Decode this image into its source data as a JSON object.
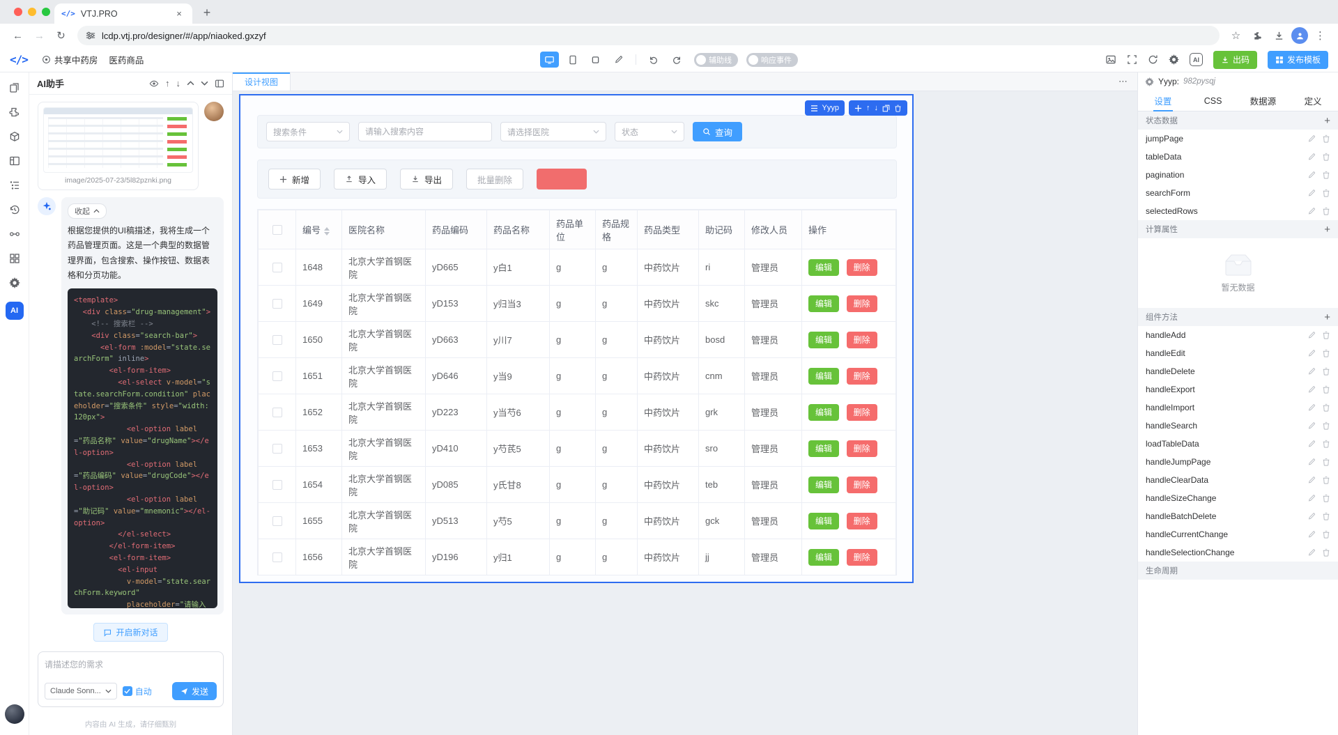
{
  "browser": {
    "tab_title": "VTJ.PRO",
    "url": "lcdp.vtj.pro/designer/#/app/niaoked.gxzyf"
  },
  "toolbar": {
    "breadcrumb1": "共享中药房",
    "breadcrumb2": "医药商品",
    "guide_toggle": "辅助线",
    "event_toggle": "响应事件",
    "export_code": "出码",
    "publish": "发布模板"
  },
  "ai_panel": {
    "title": "AI助手",
    "attachment_name": "image/2025-07-23/5l82pznki.png",
    "collapse": "收起",
    "message": "根据您提供的UI稿描述，我将生成一个药品管理页面。这是一个典型的数据管理界面，包含搜索、操作按钮、数据表格和分页功能。",
    "code": "<template>\n  <div class=\"drug-management\">\n    <!-- 搜索栏 -->\n    <div class=\"search-bar\">\n      <el-form :model=\"state.searchForm\" inline>\n        <el-form-item>\n          <el-select v-model=\"state.searchForm.condition\" placeholder=\"搜索条件\" style=\"width: 120px\">\n            <el-option label=\"药品名称\" value=\"drugName\"></el-option>\n            <el-option label=\"药品编码\" value=\"drugCode\"></el-option>\n            <el-option label=\"助记码\" value=\"mnemonic\"></el-option>\n          </el-select>\n        </el-form-item>\n        <el-form-item>\n          <el-input\n            v-model=\"state.searchForm.keyword\"\n            placeholder=\"请输入搜索内容\"",
    "new_chat": "开启新对话",
    "input_placeholder": "请描述您的需求",
    "model": "Claude Sonn...",
    "auto": "自动",
    "send": "发送",
    "disclaimer": "内容由 AI 生成，请仔细甄别"
  },
  "canvas": {
    "view_tab": "设计视图",
    "selection": {
      "name": "Yyyp"
    },
    "search": {
      "condition_placeholder": "搜索条件",
      "keyword_placeholder": "请输入搜索内容",
      "hospital_placeholder": "请选择医院",
      "status_placeholder": "状态",
      "submit": "查询"
    },
    "actions": {
      "add": "新增",
      "import": "导入",
      "export": "导出",
      "batch_delete": "批量删除"
    },
    "table": {
      "headers": [
        "编号",
        "医院名称",
        "药品编码",
        "药品名称",
        "药品单位",
        "药品规格",
        "药品类型",
        "助记码",
        "修改人员",
        "操作"
      ],
      "edit_label": "编辑",
      "delete_label": "删除",
      "rows": [
        {
          "id": "1648",
          "hospital": "北京大学首钢医院",
          "code": "yD665",
          "name": "y白1",
          "unit": "g",
          "spec": "g",
          "type": "中药饮片",
          "mnemonic": "ri",
          "editor": "管理员"
        },
        {
          "id": "1649",
          "hospital": "北京大学首钢医院",
          "code": "yD153",
          "name": "y归当3",
          "unit": "g",
          "spec": "g",
          "type": "中药饮片",
          "mnemonic": "skc",
          "editor": "管理员"
        },
        {
          "id": "1650",
          "hospital": "北京大学首钢医院",
          "code": "yD663",
          "name": "y川7",
          "unit": "g",
          "spec": "g",
          "type": "中药饮片",
          "mnemonic": "bosd",
          "editor": "管理员"
        },
        {
          "id": "1651",
          "hospital": "北京大学首钢医院",
          "code": "yD646",
          "name": "y当9",
          "unit": "g",
          "spec": "g",
          "type": "中药饮片",
          "mnemonic": "cnm",
          "editor": "管理员"
        },
        {
          "id": "1652",
          "hospital": "北京大学首钢医院",
          "code": "yD223",
          "name": "y当芍6",
          "unit": "g",
          "spec": "g",
          "type": "中药饮片",
          "mnemonic": "grk",
          "editor": "管理员"
        },
        {
          "id": "1653",
          "hospital": "北京大学首钢医院",
          "code": "yD410",
          "name": "y芍芪5",
          "unit": "g",
          "spec": "g",
          "type": "中药饮片",
          "mnemonic": "sro",
          "editor": "管理员"
        },
        {
          "id": "1654",
          "hospital": "北京大学首钢医院",
          "code": "yD085",
          "name": "y氏甘8",
          "unit": "g",
          "spec": "g",
          "type": "中药饮片",
          "mnemonic": "teb",
          "editor": "管理员"
        },
        {
          "id": "1655",
          "hospital": "北京大学首钢医院",
          "code": "yD513",
          "name": "y芍5",
          "unit": "g",
          "spec": "g",
          "type": "中药饮片",
          "mnemonic": "gck",
          "editor": "管理员"
        },
        {
          "id": "1656",
          "hospital": "北京大学首钢医院",
          "code": "yD196",
          "name": "y归1",
          "unit": "g",
          "spec": "g",
          "type": "中药饮片",
          "mnemonic": "jj",
          "editor": "管理员"
        }
      ]
    }
  },
  "inspector": {
    "component": "Yyyp:",
    "component_id": "982pysqj",
    "tabs": [
      "设置",
      "CSS",
      "数据源",
      "定义"
    ],
    "state": {
      "title": "状态数据",
      "items": [
        "jumpPage",
        "tableData",
        "pagination",
        "searchForm",
        "selectedRows"
      ]
    },
    "computed": {
      "title": "计算属性",
      "empty": "暂无数据"
    },
    "methods": {
      "title": "组件方法",
      "items": [
        "handleAdd",
        "handleEdit",
        "handleDelete",
        "handleExport",
        "handleImport",
        "handleSearch",
        "loadTableData",
        "handleJumpPage",
        "handleClearData",
        "handleSizeChange",
        "handleBatchDelete",
        "handleCurrentChange",
        "handleSelectionChange"
      ]
    },
    "lifecycle": {
      "title": "生命周期"
    }
  }
}
